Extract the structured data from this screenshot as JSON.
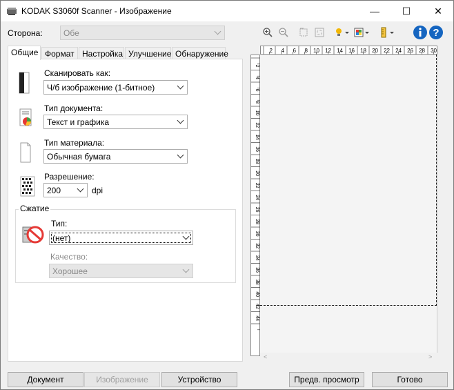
{
  "window": {
    "title": "KODAK S3060f Scanner - Изображение",
    "minimize_glyph": "—",
    "maximize_glyph": "☐",
    "close_glyph": "✕"
  },
  "side": {
    "label": "Сторона:",
    "value": "Обе"
  },
  "tabs": [
    {
      "label": "Общие",
      "active": true
    },
    {
      "label": "Формат"
    },
    {
      "label": "Настройка"
    },
    {
      "label": "Улучшение"
    },
    {
      "label": "Обнаружение"
    }
  ],
  "general": {
    "scan_as_label": "Сканировать как:",
    "scan_as_value": "Ч/б изображение (1-битное)",
    "doc_type_label": "Тип документа:",
    "doc_type_value": "Текст и графика",
    "material_label": "Тип материала:",
    "material_value": "Обычная бумага",
    "resolution_label": "Разрешение:",
    "resolution_value": "200",
    "resolution_unit": "dpi",
    "compression_title": "Сжатие",
    "compression_type_label": "Тип:",
    "compression_type_value": "(нет)",
    "quality_label": "Качество:",
    "quality_value": "Хорошее"
  },
  "ruler": {
    "top_ticks": [
      "2",
      "4",
      "6",
      "8",
      "10",
      "12",
      "14",
      "16",
      "18",
      "20",
      "22",
      "24",
      "26",
      "28",
      "30"
    ],
    "left_ticks": [
      "2",
      "4",
      "6",
      "8",
      "10",
      "12",
      "14",
      "16",
      "18",
      "20",
      "22",
      "24",
      "26",
      "28",
      "30",
      "32",
      "34",
      "36",
      "38",
      "40",
      "42",
      "44"
    ]
  },
  "buttons": {
    "document": "Документ",
    "image": "Изображение",
    "device": "Устройство",
    "preview": "Предв. просмотр",
    "done": "Готово"
  },
  "colors": {
    "info_blue": "#1565c0",
    "accent": "#0078d7"
  }
}
